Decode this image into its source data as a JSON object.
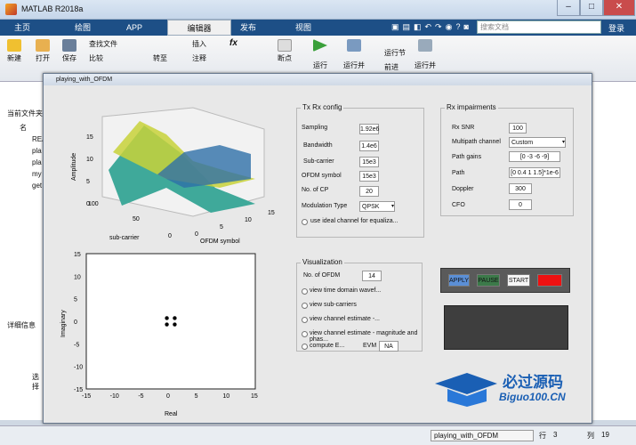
{
  "app": {
    "title": "MATLAB R2018a"
  },
  "tabs": [
    {
      "label": "主页"
    },
    {
      "label": "绘图"
    },
    {
      "label": "APP"
    },
    {
      "label": "编辑器"
    },
    {
      "label": "发布"
    },
    {
      "label": "视图"
    }
  ],
  "search": {
    "placeholder": "搜索文档"
  },
  "login": "登录",
  "toolstrip": {
    "new": "新建",
    "open": "打开",
    "save": "保存",
    "findfile": "查找文件",
    "compare": "比较",
    "goto": "转至",
    "insert": "插入",
    "comment": "注释",
    "fx": "fx",
    "breakpoint": "断点",
    "run": "运行",
    "runadv": "运行并",
    "runsection": "运行节",
    "advance": "前进",
    "runandtime": "运行并"
  },
  "leftpanel": {
    "header": "当前文件夹",
    "name": "名",
    "files": [
      "REA",
      "pla",
      "pla",
      "my",
      "get"
    ],
    "details": "详细信息",
    "select": "选择"
  },
  "figure": {
    "title": "playing_with_OFDM",
    "txrx": {
      "title": "Tx Rx config",
      "sampling_label": "Sampling",
      "sampling": "1.92e6",
      "bandwidth_label": "Bandwidth",
      "bandwidth": "1.4e6",
      "subcarrier_label": "Sub-carrier",
      "subcarrier": "15e3",
      "ofdm_label": "OFDM symbol",
      "ofdm": "15e3",
      "cp_label": "No. of CP",
      "cp": "20",
      "mod_label": "Modulation Type",
      "mod": "QPSK",
      "ideal": "use ideal channel for equaliza..."
    },
    "rx": {
      "title": "Rx impairments",
      "snr_label": "Rx SNR",
      "snr": "100",
      "mpc_label": "Multipath channel",
      "mpc": "Custom",
      "gains_label": "Path gains",
      "gains": "[0 -3 -6 -9]",
      "path_label": "Path",
      "path": "[0 0.4 1 1.5]*1e-6",
      "doppler_label": "Doppler",
      "doppler": "300",
      "cfo_label": "CFO",
      "cfo": "0"
    },
    "vis": {
      "title": "Visualization",
      "nofdm_label": "No. of OFDM",
      "nofdm": "14",
      "opt1": "view time domain wavef...",
      "opt2": "view sub-carriers",
      "opt3": "view channel estimate -...",
      "opt4": "view channel estimate - magnitude and phas...",
      "opt5": "compute E...",
      "evm_label": "EVM",
      "evm": "NA"
    },
    "buttons": {
      "apply": "APPLY",
      "pause": "PAUSE",
      "start": "START",
      "stop": ""
    },
    "plot3d": {
      "zlabel": "Amplitude",
      "xlabel": "sub-carrier",
      "ylabel": "OFDM symbol",
      "zticks": [
        "15",
        "10",
        "5",
        "0"
      ],
      "xticks": [
        "100",
        "50",
        "0"
      ],
      "yticks": [
        "0",
        "5",
        "10",
        "15"
      ]
    },
    "scatter": {
      "xlabel": "Real",
      "ylabel": "Imaginary",
      "ticks": [
        "-15",
        "-10",
        "-5",
        "0",
        "5",
        "10",
        "15"
      ],
      "yticks": [
        "15",
        "10",
        "5",
        "0",
        "-5",
        "-10",
        "-15"
      ]
    }
  },
  "status": {
    "file": "playing_with_OFDM",
    "row_label": "行",
    "row": "3",
    "col_label": "列",
    "col": "19"
  },
  "watermark": {
    "text": "必过源码",
    "url": "Biguo100.CN"
  },
  "colors": {
    "tabbar": "#1d4f86",
    "apply": "#5b8fd6",
    "pause": "#3c7a4a",
    "stop": "#ee1111"
  },
  "chart_data": [
    {
      "type": "surface",
      "title": "",
      "xlabel": "sub-carrier",
      "ylabel": "OFDM symbol",
      "zlabel": "Amplitude",
      "xlim": [
        0,
        100
      ],
      "ylim": [
        0,
        15
      ],
      "zlim": [
        0,
        15
      ]
    },
    {
      "type": "scatter",
      "title": "",
      "xlabel": "Real",
      "ylabel": "Imaginary",
      "xlim": [
        -15,
        15
      ],
      "ylim": [
        -15,
        15
      ],
      "series": [
        {
          "x": [
            -0.7,
            0.7,
            -0.7,
            0.7
          ],
          "y": [
            0.7,
            0.7,
            -0.7,
            -0.7
          ]
        }
      ]
    }
  ]
}
